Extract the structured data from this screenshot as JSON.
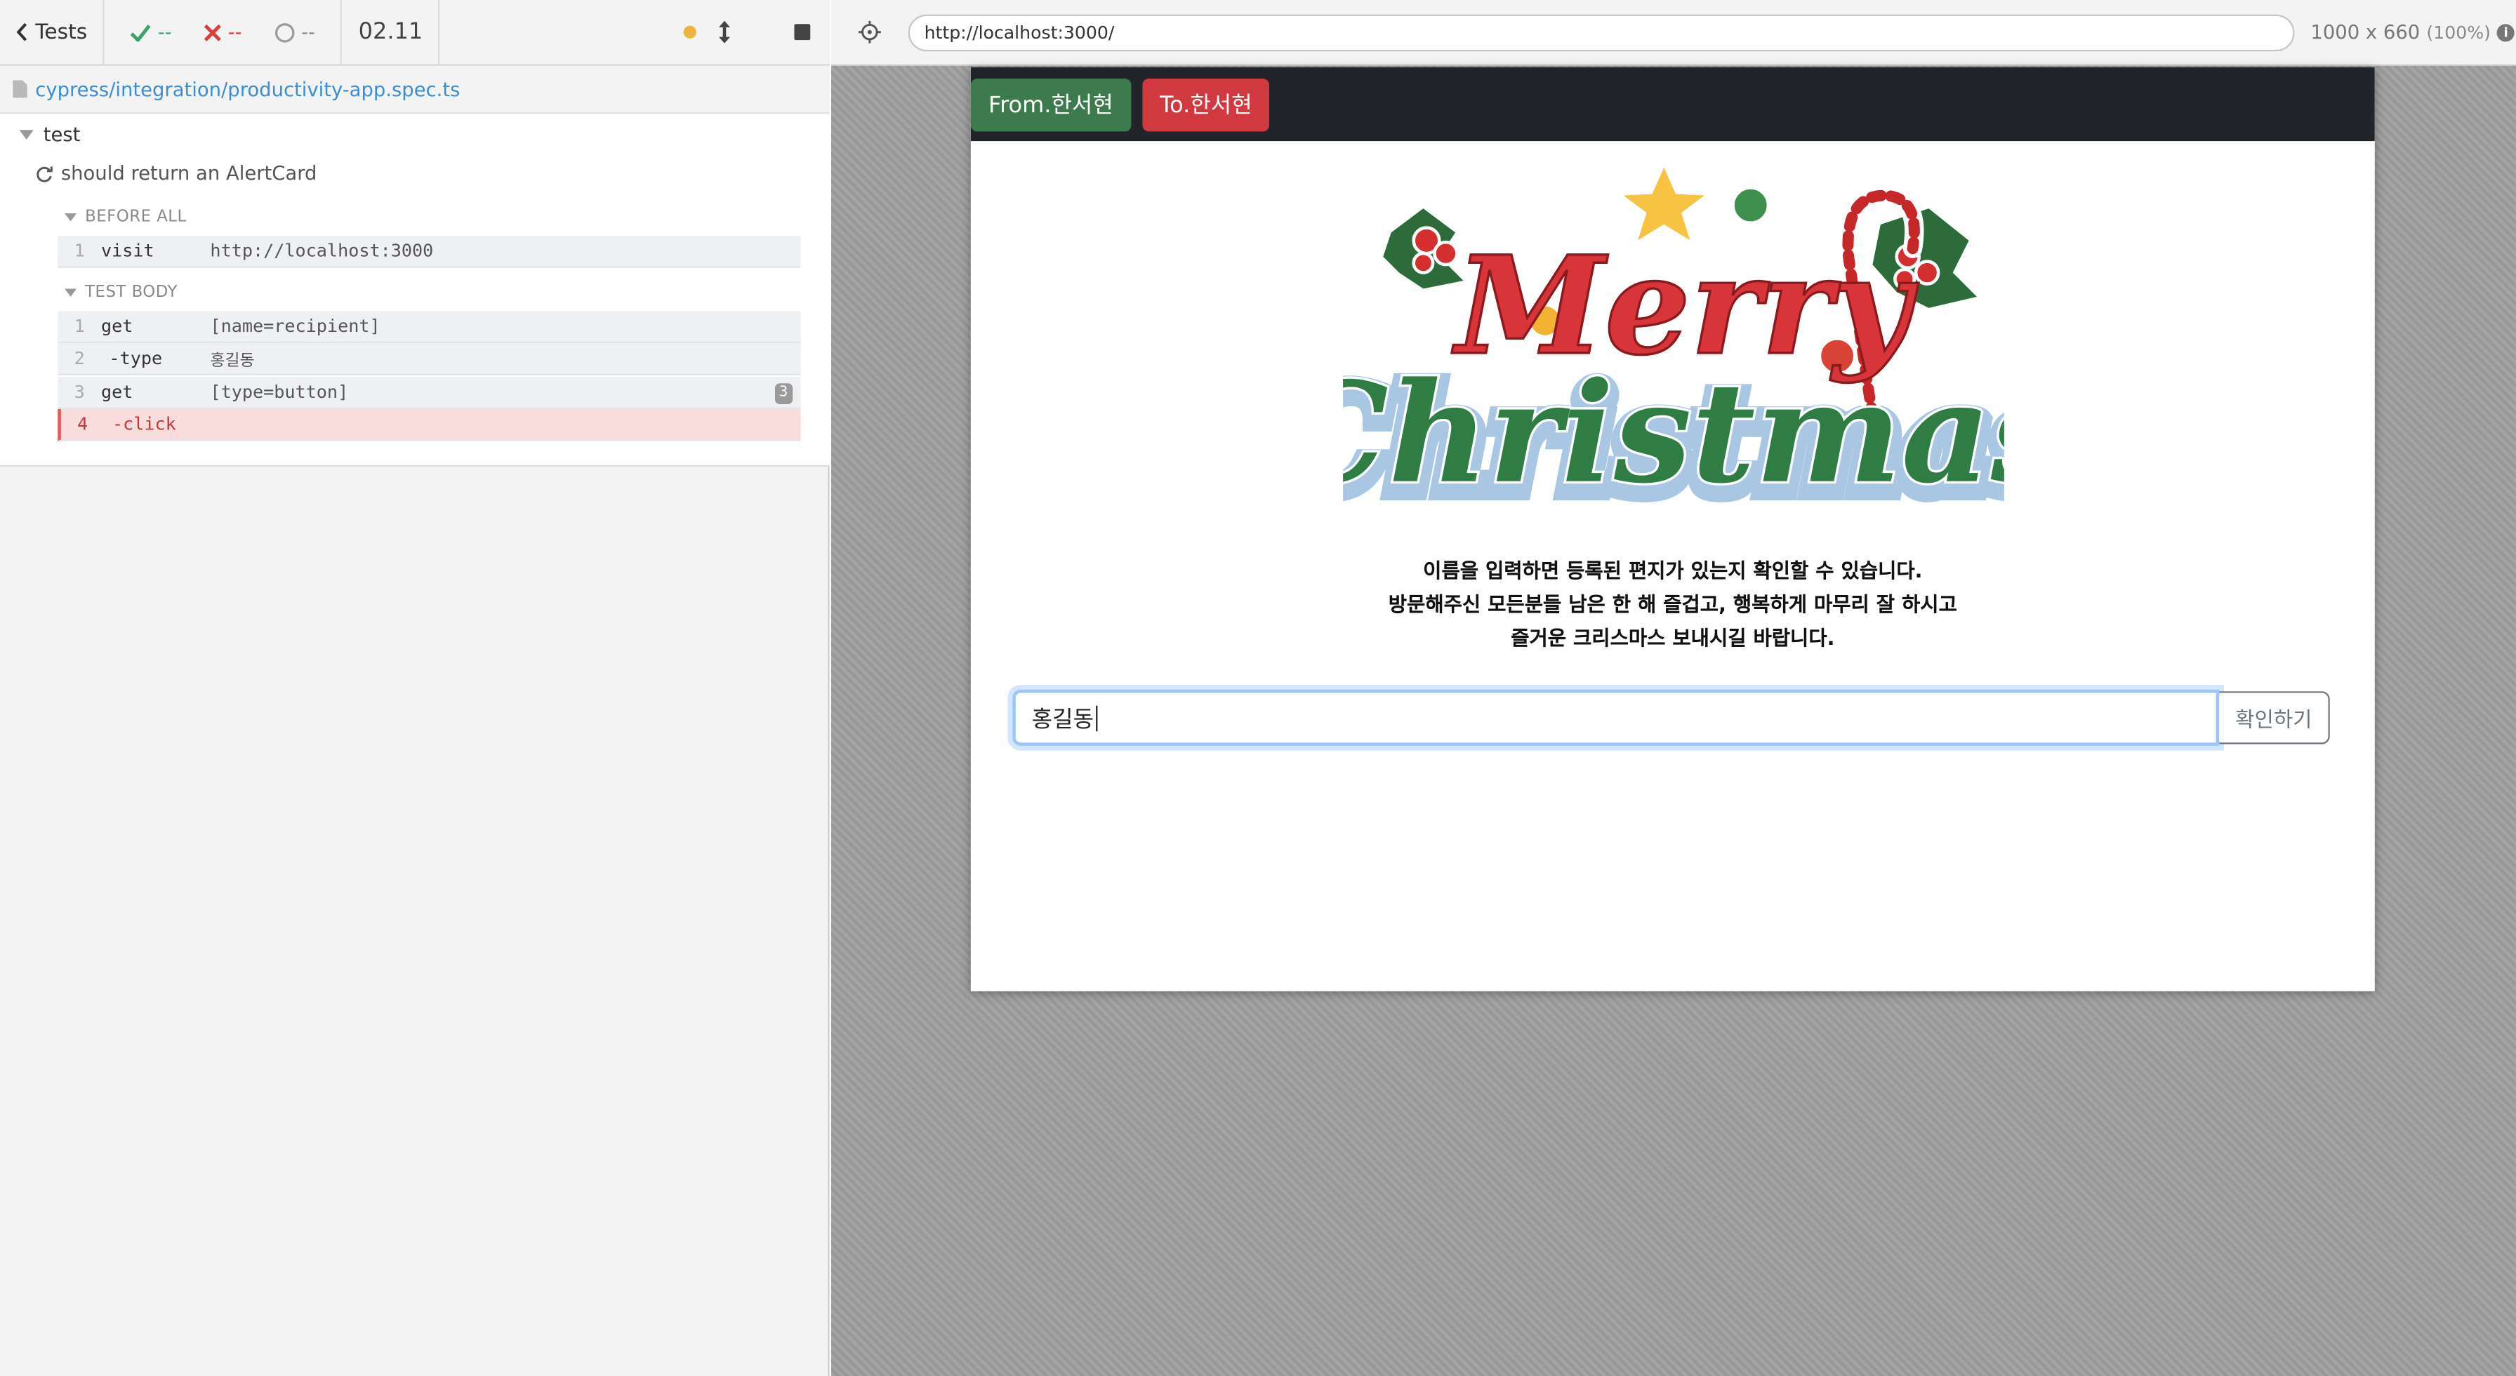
{
  "reporter": {
    "tests_label": "Tests",
    "passed": "--",
    "failed": "--",
    "pending": "--",
    "duration": "02.11",
    "spec_path": "cypress/integration/productivity-app.spec.ts",
    "suite_title": "test",
    "test_title": "should return an AlertCard",
    "hooks": {
      "before_all": "BEFORE ALL",
      "test_body": "TEST BODY"
    },
    "before_all_commands": [
      {
        "num": "1",
        "name": "visit",
        "message": "http://localhost:3000"
      }
    ],
    "body_commands": [
      {
        "num": "1",
        "name": "get",
        "message": "[name=recipient]"
      },
      {
        "num": "2",
        "name": "-type",
        "message": "홍길동"
      },
      {
        "num": "3",
        "name": "get",
        "message": "[type=button]",
        "badge": "3"
      },
      {
        "num": "4",
        "name": "-click",
        "message": "",
        "state": "failed"
      }
    ]
  },
  "aut_header": {
    "url": "http://localhost:3000/",
    "viewport_size": "1000 x 660",
    "viewport_scale": "(100%)"
  },
  "app": {
    "from_button": "From.한서현",
    "to_button": "To.한서현",
    "logo_line1": "Merry",
    "logo_line2": "Christmas",
    "message_lines": [
      "이름을 입력하면 등록된 편지가 있는지 확인할 수 있습니다.",
      "방문해주신 모든분들 남은 한 해 즐겁고, 행복하게 마무리 잘 하시고",
      "즐거운 크리스마스 보내시길 바랍니다."
    ],
    "input_value": "홍길동",
    "confirm_button": "확인하기"
  },
  "colors": {
    "green_button": "#3d7b4f",
    "red_button": "#d0393f",
    "navbar": "#212529",
    "link_blue": "#3a8ed6",
    "failed_row": "#f9dcdc"
  }
}
